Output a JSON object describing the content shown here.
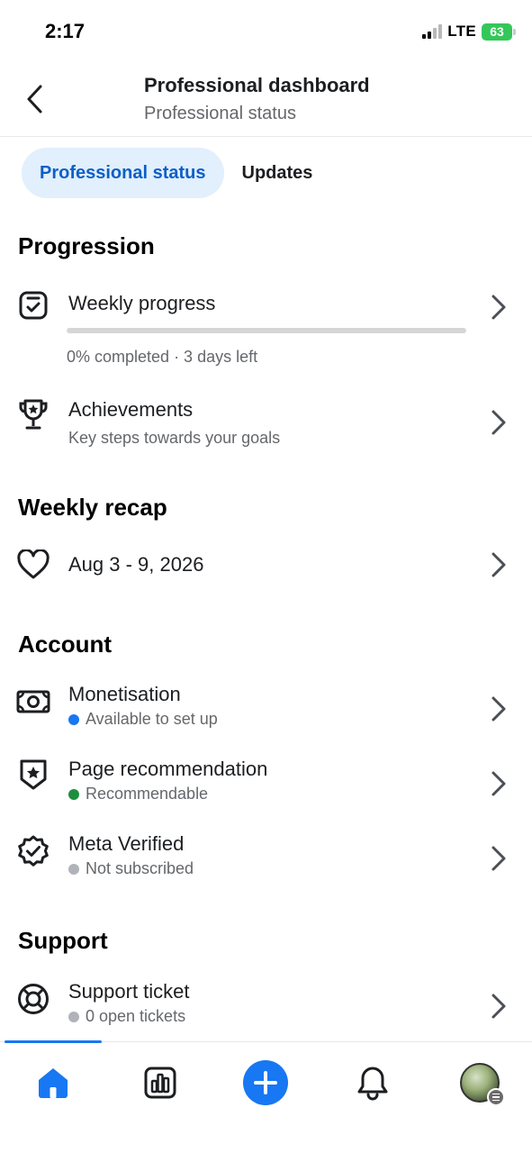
{
  "status_bar": {
    "time": "2:17",
    "network": "LTE",
    "battery": "63"
  },
  "header": {
    "title": "Professional dashboard",
    "subtitle": "Professional status"
  },
  "tabs": [
    {
      "label": "Professional status",
      "active": true
    },
    {
      "label": "Updates",
      "active": false
    }
  ],
  "progression": {
    "title": "Progression",
    "weekly_progress": {
      "label": "Weekly progress",
      "progress_percent": 0,
      "status": "0% completed · 3 days left"
    },
    "achievements": {
      "label": "Achievements",
      "subtitle": "Key steps towards your goals"
    }
  },
  "weekly_recap": {
    "title": "Weekly recap",
    "range": "Aug 3 - 9, 2026"
  },
  "account": {
    "title": "Account",
    "items": [
      {
        "label": "Monetisation",
        "status": "Available to set up",
        "dot_color": "#1877f2",
        "icon": "money-icon"
      },
      {
        "label": "Page recommendation",
        "status": "Recommendable",
        "dot_color": "#1e8e3e",
        "icon": "star-shield-icon"
      },
      {
        "label": "Meta Verified",
        "status": "Not subscribed",
        "dot_color": "#b0b3b8",
        "icon": "verified-badge-icon"
      }
    ]
  },
  "support": {
    "title": "Support",
    "ticket": {
      "label": "Support ticket",
      "status": "0 open tickets",
      "dot_color": "#b0b3b8"
    }
  },
  "colors": {
    "accent": "#1877f2",
    "tab_active_bg": "#e2effc",
    "secondary_text": "#65676b"
  },
  "bottom_nav": [
    "home-icon",
    "insights-icon",
    "create-icon",
    "notifications-icon",
    "profile-avatar"
  ]
}
